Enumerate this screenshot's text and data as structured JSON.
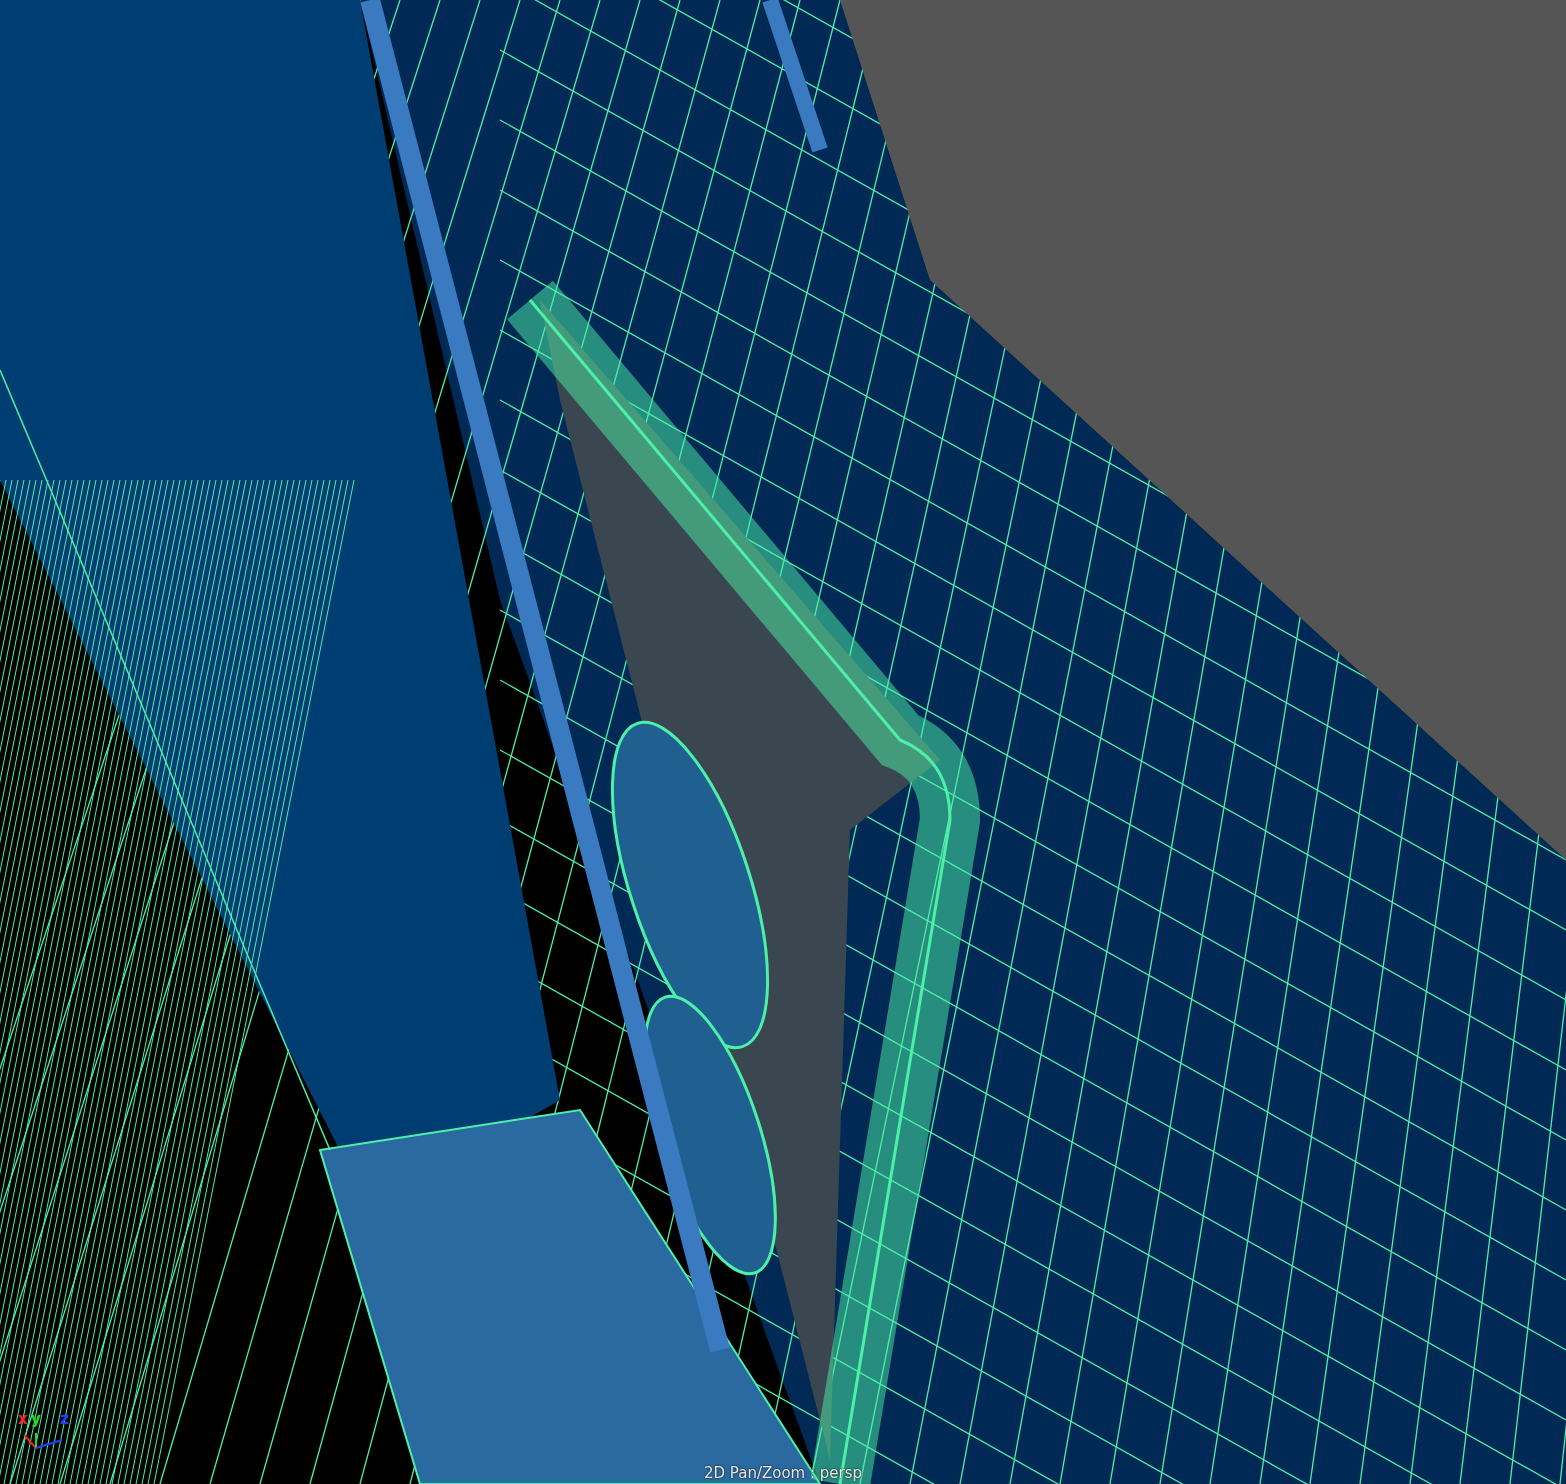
{
  "viewport": {
    "axis_labels": [
      {
        "kind": "x",
        "text": "x",
        "color": "#ff2020"
      },
      {
        "kind": "y",
        "text": "y",
        "color": "#20e020"
      },
      {
        "kind": "z",
        "text": "z",
        "color": "#2040ff"
      }
    ],
    "hud_label": "2D Pan/Zoom : persp"
  }
}
